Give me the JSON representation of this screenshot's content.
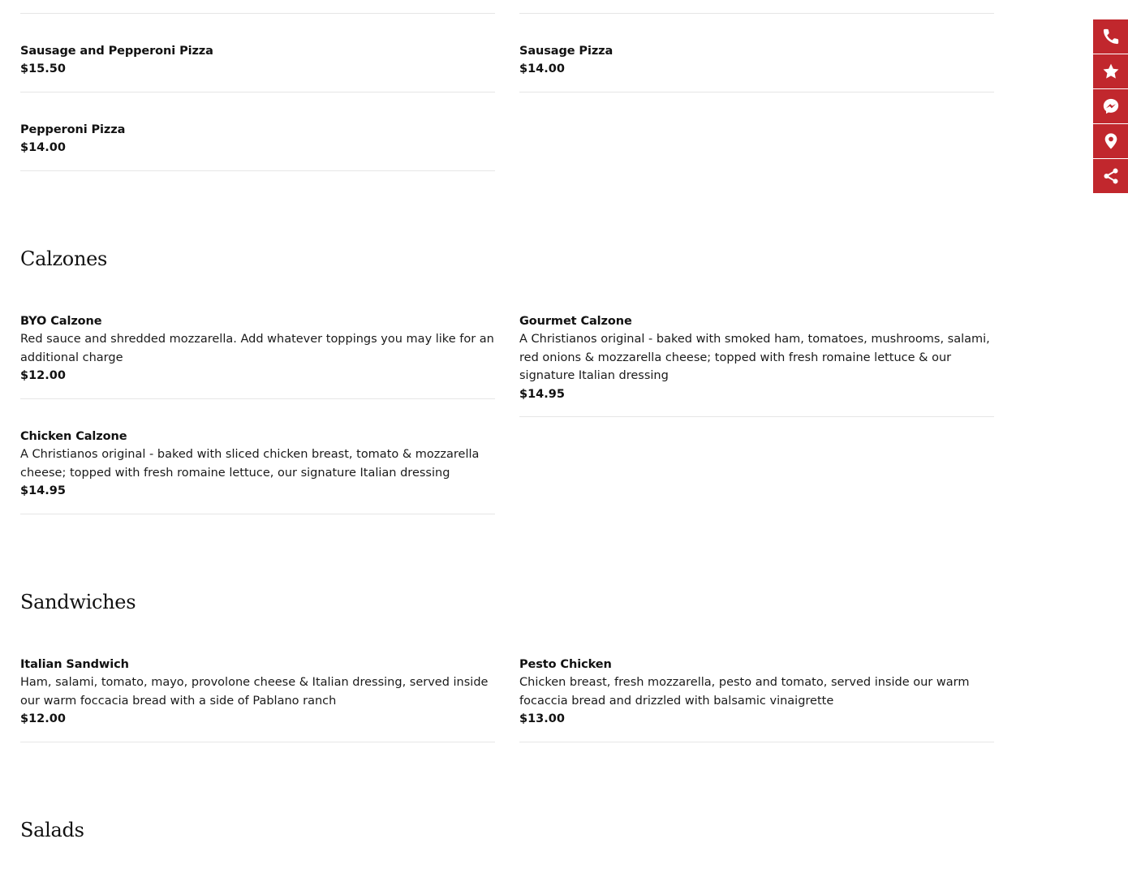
{
  "menu": {
    "pizza_items": [
      {
        "name": "Sausage and Pepperoni Pizza",
        "price": "$15.50"
      },
      {
        "name": "Sausage Pizza",
        "price": "$14.00"
      },
      {
        "name": "Pepperoni Pizza",
        "price": "$14.00"
      }
    ],
    "calzones": {
      "title": "Calzones",
      "items": [
        {
          "name": "BYO Calzone",
          "description": "Red sauce and shredded mozzarella. Add whatever toppings you may like for an additional charge",
          "price": "$12.00"
        },
        {
          "name": "Gourmet Calzone",
          "description": "A Christianos original - baked with smoked ham, tomatoes, mushrooms, salami, red onions & mozzarella cheese; topped with fresh romaine lettuce & our signature Italian dressing",
          "price": "$14.95"
        },
        {
          "name": "Chicken Calzone",
          "description": "A Christianos original - baked with sliced chicken breast, tomato & mozzarella cheese; topped with fresh romaine lettuce, our signature Italian dressing",
          "price": "$14.95"
        }
      ]
    },
    "sandwiches": {
      "title": "Sandwiches",
      "items": [
        {
          "name": "Italian Sandwich",
          "description": "Ham, salami, tomato, mayo, provolone cheese & Italian dressing, served inside our warm foccacia bread with a side of Pablano ranch",
          "price": "$12.00"
        },
        {
          "name": "Pesto Chicken",
          "description": "Chicken breast, fresh mozzarella, pesto and tomato, served inside our warm focaccia bread and drizzled with balsamic vinaigrette",
          "price": "$13.00"
        }
      ]
    },
    "salads": {
      "title": "Salads"
    }
  },
  "sidebar": {
    "accent_color": "#c1272d",
    "buttons": [
      {
        "icon": "phone-icon"
      },
      {
        "icon": "star-icon"
      },
      {
        "icon": "messenger-icon"
      },
      {
        "icon": "map-pin-icon"
      },
      {
        "icon": "share-icon"
      }
    ]
  }
}
